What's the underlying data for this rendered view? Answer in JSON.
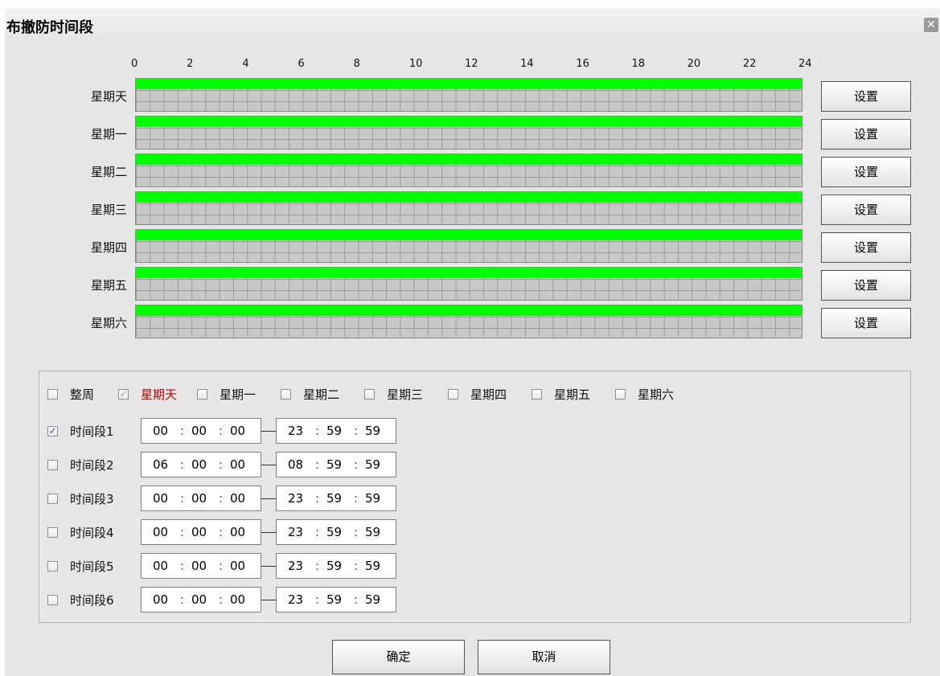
{
  "title": "布撤防时间段",
  "close_icon": "close-icon",
  "hours": [
    "0",
    "2",
    "4",
    "6",
    "8",
    "10",
    "12",
    "14",
    "16",
    "18",
    "20",
    "22",
    "24"
  ],
  "schedule": [
    {
      "day": "星期天",
      "armed": 1.0,
      "set_label": "设置"
    },
    {
      "day": "星期一",
      "armed": 1.0,
      "set_label": "设置"
    },
    {
      "day": "星期二",
      "armed": 1.0,
      "set_label": "设置"
    },
    {
      "day": "星期三",
      "armed": 1.0,
      "set_label": "设置"
    },
    {
      "day": "星期四",
      "armed": 1.0,
      "set_label": "设置"
    },
    {
      "day": "星期五",
      "armed": 1.0,
      "set_label": "设置"
    },
    {
      "day": "星期六",
      "armed": 1.0,
      "set_label": "设置"
    }
  ],
  "day_selector": [
    {
      "label": "整周",
      "checked": false,
      "disabled": false,
      "highlight": false
    },
    {
      "label": "星期天",
      "checked": true,
      "disabled": true,
      "highlight": true
    },
    {
      "label": "星期一",
      "checked": false,
      "disabled": false,
      "highlight": false
    },
    {
      "label": "星期二",
      "checked": false,
      "disabled": false,
      "highlight": false
    },
    {
      "label": "星期三",
      "checked": false,
      "disabled": false,
      "highlight": false
    },
    {
      "label": "星期四",
      "checked": false,
      "disabled": false,
      "highlight": false
    },
    {
      "label": "星期五",
      "checked": false,
      "disabled": false,
      "highlight": false
    },
    {
      "label": "星期六",
      "checked": false,
      "disabled": false,
      "highlight": false
    }
  ],
  "periods": [
    {
      "label": "时间段1",
      "checked": true,
      "start": [
        "00",
        "00",
        "00"
      ],
      "end": [
        "23",
        "59",
        "59"
      ]
    },
    {
      "label": "时间段2",
      "checked": false,
      "start": [
        "06",
        "00",
        "00"
      ],
      "end": [
        "08",
        "59",
        "59"
      ]
    },
    {
      "label": "时间段3",
      "checked": false,
      "start": [
        "00",
        "00",
        "00"
      ],
      "end": [
        "23",
        "59",
        "59"
      ]
    },
    {
      "label": "时间段4",
      "checked": false,
      "start": [
        "00",
        "00",
        "00"
      ],
      "end": [
        "23",
        "59",
        "59"
      ]
    },
    {
      "label": "时间段5",
      "checked": false,
      "start": [
        "00",
        "00",
        "00"
      ],
      "end": [
        "23",
        "59",
        "59"
      ]
    },
    {
      "label": "时间段6",
      "checked": false,
      "start": [
        "00",
        "00",
        "00"
      ],
      "end": [
        "23",
        "59",
        "59"
      ]
    }
  ],
  "time_separator": ":",
  "footer": {
    "ok_label": "确定",
    "cancel_label": "取消"
  },
  "colors": {
    "armed": "#00ff00",
    "highlight_day": "#c00000"
  }
}
